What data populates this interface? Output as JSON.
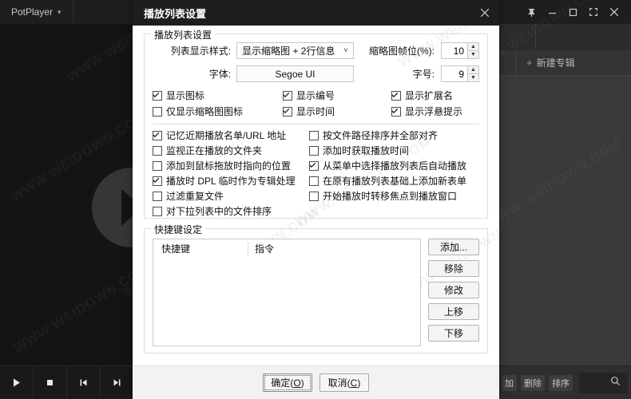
{
  "player": {
    "menu_label": "PotPlayer",
    "chevron_icon": "chevron-down-icon",
    "window_buttons": [
      {
        "name": "pin-icon",
        "label": "Pin"
      },
      {
        "name": "minimize-icon",
        "label": "Minimize"
      },
      {
        "name": "maximize-icon",
        "label": "Maximize"
      },
      {
        "name": "fullscreen-icon",
        "label": "Fullscreen"
      },
      {
        "name": "close-icon",
        "label": "Close"
      }
    ],
    "transport": [
      {
        "name": "play-icon",
        "label": "Play"
      },
      {
        "name": "stop-icon",
        "label": "Stop"
      },
      {
        "name": "previous-icon",
        "label": "Previous"
      },
      {
        "name": "next-icon",
        "label": "Next"
      }
    ],
    "playlist_panel": {
      "new_album_plus": "+",
      "new_album_label": "新建专辑",
      "mini_buttons": [
        "加",
        "删除",
        "排序"
      ],
      "search_icon": "search-icon"
    },
    "watermark_text": "WWW.WEIDOWN.COM"
  },
  "dialog": {
    "title": "播放列表设置",
    "close_icon": "close-icon",
    "group_playlist": {
      "legend": "播放列表设置",
      "list_style_label": "列表显示样式:",
      "list_style_value": "显示缩略图 + 2行信息",
      "list_style_arrow": "chevron-down-icon",
      "thumb_frame_label": "缩略图帧位(%):",
      "thumb_frame_value": "10",
      "font_label": "字体:",
      "font_value": "Segoe UI",
      "font_size_label": "字号:",
      "font_size_value": "9",
      "display_options": [
        {
          "label": "显示图标",
          "checked": true
        },
        {
          "label": "显示编号",
          "checked": true
        },
        {
          "label": "显示扩展名",
          "checked": true
        },
        {
          "label": "仅显示缩略图图标",
          "checked": false
        },
        {
          "label": "显示时间",
          "checked": true
        },
        {
          "label": "显示浮悬提示",
          "checked": true
        }
      ],
      "behavior_options_left": [
        {
          "label": "记忆近期播放名单/URL 地址",
          "checked": true
        },
        {
          "label": "监视正在播放的文件夹",
          "checked": false
        },
        {
          "label": "添加到鼠标拖放时指向的位置",
          "checked": false
        },
        {
          "label": "播放时 DPL 临时作为专辑处理",
          "checked": true
        },
        {
          "label": "过滤重复文件",
          "checked": false
        },
        {
          "label": "对下拉列表中的文件排序",
          "checked": false
        }
      ],
      "behavior_options_right": [
        {
          "label": "按文件路径排序并全部对齐",
          "checked": false
        },
        {
          "label": "添加时获取播放时间",
          "checked": false
        },
        {
          "label": "从菜单中选择播放列表后自动播放",
          "checked": true
        },
        {
          "label": "在原有播放列表基础上添加新表单",
          "checked": false
        },
        {
          "label": "开始播放时转移焦点到播放窗口",
          "checked": false
        },
        {
          "label": "",
          "checked": null
        }
      ]
    },
    "group_hotkeys": {
      "legend": "快捷键设定",
      "columns": [
        "快捷键",
        "指令"
      ],
      "rows": [],
      "buttons": [
        {
          "label": "添加...",
          "name": "add-hotkey-button"
        },
        {
          "label": "移除",
          "name": "remove-hotkey-button"
        },
        {
          "label": "修改",
          "name": "edit-hotkey-button"
        },
        {
          "label": "上移",
          "name": "move-up-button"
        },
        {
          "label": "下移",
          "name": "move-down-button"
        }
      ]
    },
    "footer": {
      "ok_pre": "确定(",
      "ok_key": "O",
      "ok_post": ")",
      "cancel_pre": "取消(",
      "cancel_key": "C",
      "cancel_post": ")"
    }
  },
  "colors": {
    "dialog_bg": "#ffffff",
    "titlebar_bg": "#1e1e1e",
    "titlebar_fg": "#ffffff",
    "footer_bg": "#f2f2f2",
    "player_bg": "#1b1b1b",
    "panel_bg": "#3a3a3a",
    "video_bg": "#141414"
  }
}
